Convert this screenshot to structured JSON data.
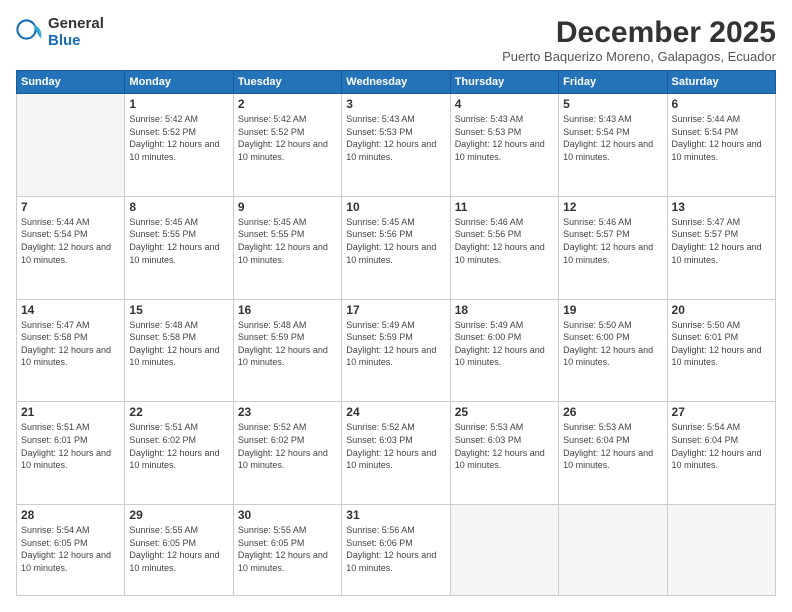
{
  "logo": {
    "general": "General",
    "blue": "Blue"
  },
  "header": {
    "month": "December 2025",
    "location": "Puerto Baquerizo Moreno, Galapagos, Ecuador"
  },
  "weekdays": [
    "Sunday",
    "Monday",
    "Tuesday",
    "Wednesday",
    "Thursday",
    "Friday",
    "Saturday"
  ],
  "weeks": [
    [
      {
        "day": "",
        "empty": true
      },
      {
        "day": "1",
        "sunrise": "5:42 AM",
        "sunset": "5:52 PM",
        "daylight": "12 hours and 10 minutes."
      },
      {
        "day": "2",
        "sunrise": "5:42 AM",
        "sunset": "5:52 PM",
        "daylight": "12 hours and 10 minutes."
      },
      {
        "day": "3",
        "sunrise": "5:43 AM",
        "sunset": "5:53 PM",
        "daylight": "12 hours and 10 minutes."
      },
      {
        "day": "4",
        "sunrise": "5:43 AM",
        "sunset": "5:53 PM",
        "daylight": "12 hours and 10 minutes."
      },
      {
        "day": "5",
        "sunrise": "5:43 AM",
        "sunset": "5:54 PM",
        "daylight": "12 hours and 10 minutes."
      },
      {
        "day": "6",
        "sunrise": "5:44 AM",
        "sunset": "5:54 PM",
        "daylight": "12 hours and 10 minutes."
      }
    ],
    [
      {
        "day": "7",
        "sunrise": "5:44 AM",
        "sunset": "5:54 PM",
        "daylight": "12 hours and 10 minutes."
      },
      {
        "day": "8",
        "sunrise": "5:45 AM",
        "sunset": "5:55 PM",
        "daylight": "12 hours and 10 minutes."
      },
      {
        "day": "9",
        "sunrise": "5:45 AM",
        "sunset": "5:55 PM",
        "daylight": "12 hours and 10 minutes."
      },
      {
        "day": "10",
        "sunrise": "5:45 AM",
        "sunset": "5:56 PM",
        "daylight": "12 hours and 10 minutes."
      },
      {
        "day": "11",
        "sunrise": "5:46 AM",
        "sunset": "5:56 PM",
        "daylight": "12 hours and 10 minutes."
      },
      {
        "day": "12",
        "sunrise": "5:46 AM",
        "sunset": "5:57 PM",
        "daylight": "12 hours and 10 minutes."
      },
      {
        "day": "13",
        "sunrise": "5:47 AM",
        "sunset": "5:57 PM",
        "daylight": "12 hours and 10 minutes."
      }
    ],
    [
      {
        "day": "14",
        "sunrise": "5:47 AM",
        "sunset": "5:58 PM",
        "daylight": "12 hours and 10 minutes."
      },
      {
        "day": "15",
        "sunrise": "5:48 AM",
        "sunset": "5:58 PM",
        "daylight": "12 hours and 10 minutes."
      },
      {
        "day": "16",
        "sunrise": "5:48 AM",
        "sunset": "5:59 PM",
        "daylight": "12 hours and 10 minutes."
      },
      {
        "day": "17",
        "sunrise": "5:49 AM",
        "sunset": "5:59 PM",
        "daylight": "12 hours and 10 minutes."
      },
      {
        "day": "18",
        "sunrise": "5:49 AM",
        "sunset": "6:00 PM",
        "daylight": "12 hours and 10 minutes."
      },
      {
        "day": "19",
        "sunrise": "5:50 AM",
        "sunset": "6:00 PM",
        "daylight": "12 hours and 10 minutes."
      },
      {
        "day": "20",
        "sunrise": "5:50 AM",
        "sunset": "6:01 PM",
        "daylight": "12 hours and 10 minutes."
      }
    ],
    [
      {
        "day": "21",
        "sunrise": "5:51 AM",
        "sunset": "6:01 PM",
        "daylight": "12 hours and 10 minutes."
      },
      {
        "day": "22",
        "sunrise": "5:51 AM",
        "sunset": "6:02 PM",
        "daylight": "12 hours and 10 minutes."
      },
      {
        "day": "23",
        "sunrise": "5:52 AM",
        "sunset": "6:02 PM",
        "daylight": "12 hours and 10 minutes."
      },
      {
        "day": "24",
        "sunrise": "5:52 AM",
        "sunset": "6:03 PM",
        "daylight": "12 hours and 10 minutes."
      },
      {
        "day": "25",
        "sunrise": "5:53 AM",
        "sunset": "6:03 PM",
        "daylight": "12 hours and 10 minutes."
      },
      {
        "day": "26",
        "sunrise": "5:53 AM",
        "sunset": "6:04 PM",
        "daylight": "12 hours and 10 minutes."
      },
      {
        "day": "27",
        "sunrise": "5:54 AM",
        "sunset": "6:04 PM",
        "daylight": "12 hours and 10 minutes."
      }
    ],
    [
      {
        "day": "28",
        "sunrise": "5:54 AM",
        "sunset": "6:05 PM",
        "daylight": "12 hours and 10 minutes."
      },
      {
        "day": "29",
        "sunrise": "5:55 AM",
        "sunset": "6:05 PM",
        "daylight": "12 hours and 10 minutes."
      },
      {
        "day": "30",
        "sunrise": "5:55 AM",
        "sunset": "6:05 PM",
        "daylight": "12 hours and 10 minutes."
      },
      {
        "day": "31",
        "sunrise": "5:56 AM",
        "sunset": "6:06 PM",
        "daylight": "12 hours and 10 minutes."
      },
      {
        "day": "",
        "empty": true
      },
      {
        "day": "",
        "empty": true
      },
      {
        "day": "",
        "empty": true
      }
    ]
  ]
}
